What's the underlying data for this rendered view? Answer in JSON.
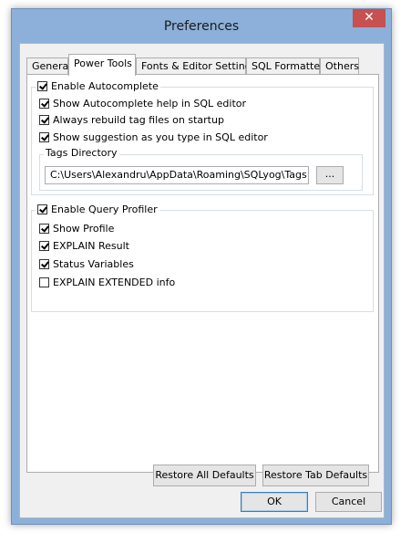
{
  "window": {
    "title": "Preferences",
    "close_label": "✕"
  },
  "tabs": [
    {
      "label": "General"
    },
    {
      "label": "Power Tools"
    },
    {
      "label": "Fonts & Editor Settings"
    },
    {
      "label": "SQL Formatter"
    },
    {
      "label": "Others"
    }
  ],
  "autocomplete": {
    "title": "Enable Autocomplete",
    "checked": true,
    "options": [
      {
        "label": "Show Autocomplete help in SQL editor",
        "checked": true
      },
      {
        "label": "Always rebuild tag files on startup",
        "checked": true
      },
      {
        "label": "Show suggestion as you type in SQL editor",
        "checked": true
      }
    ],
    "tags_directory": {
      "title": "Tags Directory",
      "value": "C:\\Users\\Alexandru\\AppData\\Roaming\\SQLyog\\Tags",
      "browse_label": "..."
    }
  },
  "profiler": {
    "title": "Enable Query Profiler",
    "checked": true,
    "options": [
      {
        "label": "Show Profile",
        "checked": true
      },
      {
        "label": "EXPLAIN Result",
        "checked": true
      },
      {
        "label": "Status Variables",
        "checked": true
      },
      {
        "label": "EXPLAIN EXTENDED info",
        "checked": false
      }
    ]
  },
  "buttons": {
    "restore_all": "Restore All Defaults",
    "restore_tab": "Restore Tab Defaults",
    "ok": "OK",
    "cancel": "Cancel"
  }
}
